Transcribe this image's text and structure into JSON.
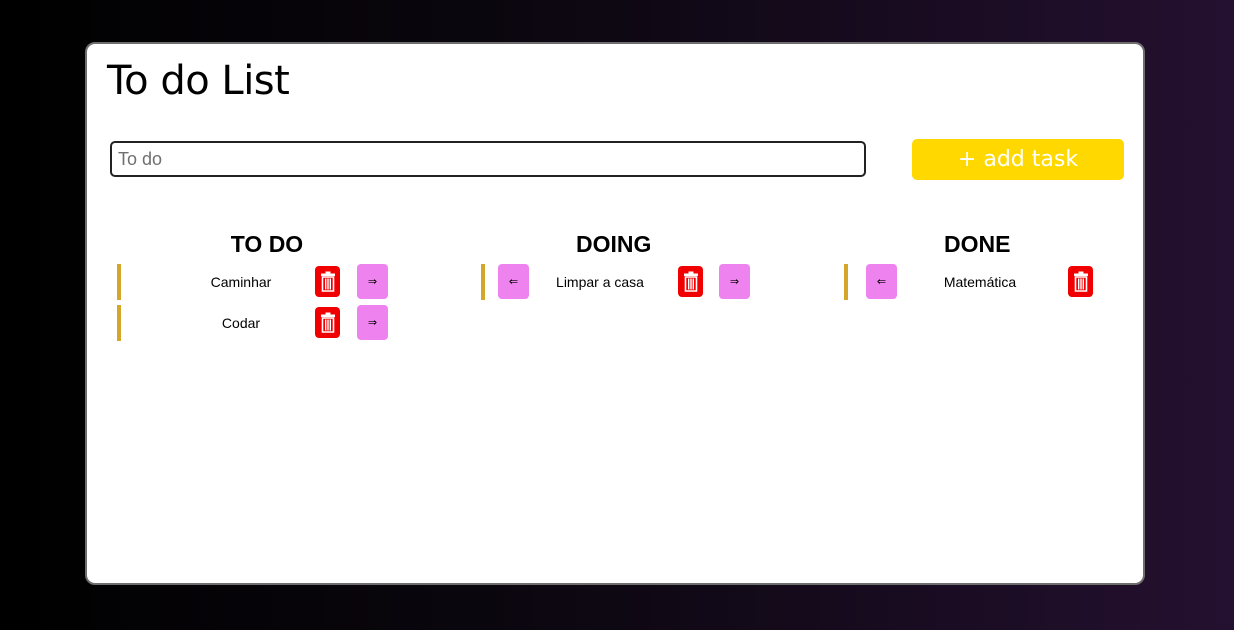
{
  "app": {
    "title": "To do List"
  },
  "input": {
    "placeholder": "To do",
    "value": ""
  },
  "add_button": {
    "label": "+ add task"
  },
  "icons": {
    "trash": "trash-icon",
    "move_right": "⇒",
    "move_left": "⇐"
  },
  "colors": {
    "accent_yellow": "#ffd800",
    "delete_red": "#f00000",
    "move_pink": "#ee82ee",
    "task_bar": "#d4a62a"
  },
  "columns": [
    {
      "title": "TO DO",
      "tasks": [
        {
          "label": "Caminhar"
        },
        {
          "label": "Codar"
        }
      ]
    },
    {
      "title": "DOING",
      "tasks": [
        {
          "label": "Limpar a casa"
        }
      ]
    },
    {
      "title": "DONE",
      "tasks": [
        {
          "label": "Matemática"
        }
      ]
    }
  ]
}
